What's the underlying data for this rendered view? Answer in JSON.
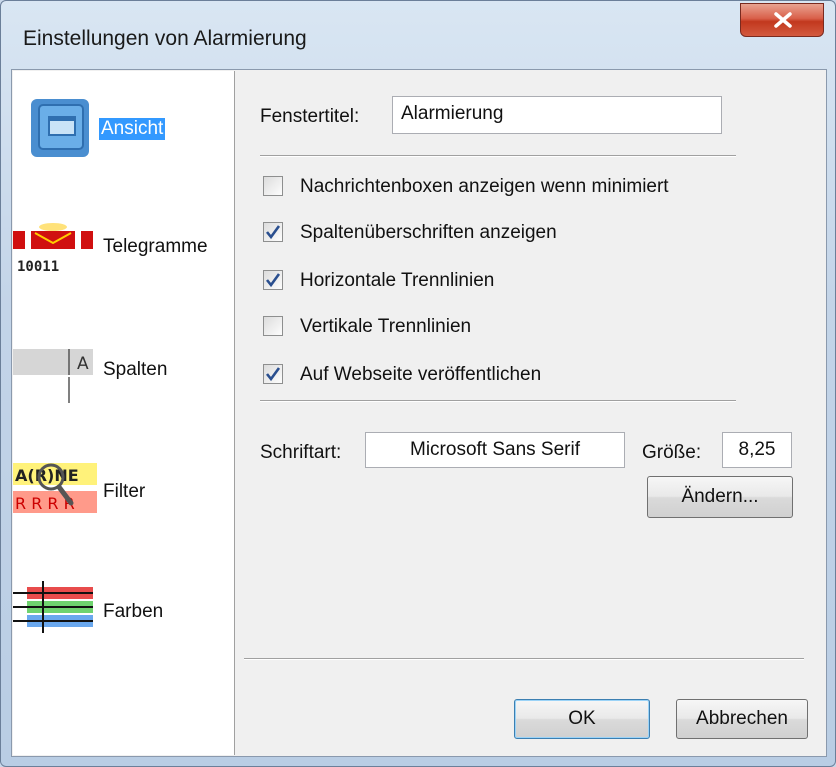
{
  "window": {
    "title": "Einstellungen von Alarmierung"
  },
  "sidebar": {
    "items": [
      {
        "label": "Ansicht",
        "icon": "window-icon",
        "selected": true
      },
      {
        "label": "Telegramme",
        "icon": "telegram-icon",
        "icon_text": "10011",
        "selected": false
      },
      {
        "label": "Spalten",
        "icon": "columns-icon",
        "icon_text": "A",
        "selected": false
      },
      {
        "label": "Filter",
        "icon": "filter-magnifier-icon",
        "icon_text_top": "A(R)NE",
        "icon_text_bottom": "R R R R",
        "selected": false
      },
      {
        "label": "Farben",
        "icon": "color-lines-icon",
        "selected": false
      }
    ]
  },
  "settings": {
    "window_title_label": "Fenstertitel:",
    "window_title_value": "Alarmierung",
    "checkboxes": [
      {
        "label": "Nachrichtenboxen anzeigen wenn minimiert",
        "checked": false
      },
      {
        "label": "Spaltenüberschriften anzeigen",
        "checked": true
      },
      {
        "label": "Horizontale Trennlinien",
        "checked": true
      },
      {
        "label": "Vertikale Trennlinien",
        "checked": false
      },
      {
        "label": "Auf Webseite veröffentlichen",
        "checked": true
      }
    ],
    "font_label": "Schriftart:",
    "font_value": "Microsoft Sans Serif",
    "size_label": "Größe:",
    "size_value": "8,25",
    "change_button": "Ändern..."
  },
  "footer": {
    "ok_label": "OK",
    "cancel_label": "Abbrechen"
  },
  "colors": {
    "selection": "#3399ff",
    "checkmark": "#2a4f8f",
    "close_button": "#c2381e"
  }
}
